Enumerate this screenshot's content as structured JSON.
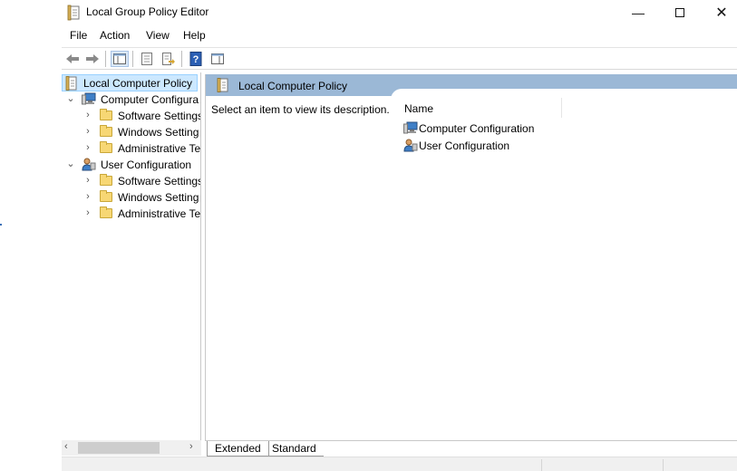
{
  "window": {
    "title": "Local Group Policy Editor",
    "controls": [
      "minimize-icon",
      "maximize-icon",
      "close-icon"
    ]
  },
  "menu": {
    "items": [
      "File",
      "Action",
      "View",
      "Help"
    ]
  },
  "toolbar": {
    "buttons": [
      "back-arrow-icon",
      "forward-arrow-icon",
      "show-hide-tree-icon",
      "properties-icon",
      "export-list-icon",
      "help-icon",
      "show-hide-action-pane-icon"
    ]
  },
  "tree": {
    "root": "Local Computer Policy",
    "computer": {
      "label": "Computer Configura",
      "children": [
        "Software Settings",
        "Windows Setting",
        "Administrative Te"
      ]
    },
    "user": {
      "label": "User Configuration",
      "children": [
        "Software Settings",
        "Windows Setting",
        "Administrative Te"
      ]
    }
  },
  "main": {
    "header_title": "Local Computer Policy",
    "description": "Select an item to view its description.",
    "column_name": "Name",
    "items": [
      "Computer Configuration",
      "User Configuration"
    ]
  },
  "tabs": {
    "extended": "Extended",
    "standard": "Standard"
  },
  "colors": {
    "header_band": "#9bb8d6",
    "selection": "#cce8ff",
    "folder": "#f7d774"
  }
}
